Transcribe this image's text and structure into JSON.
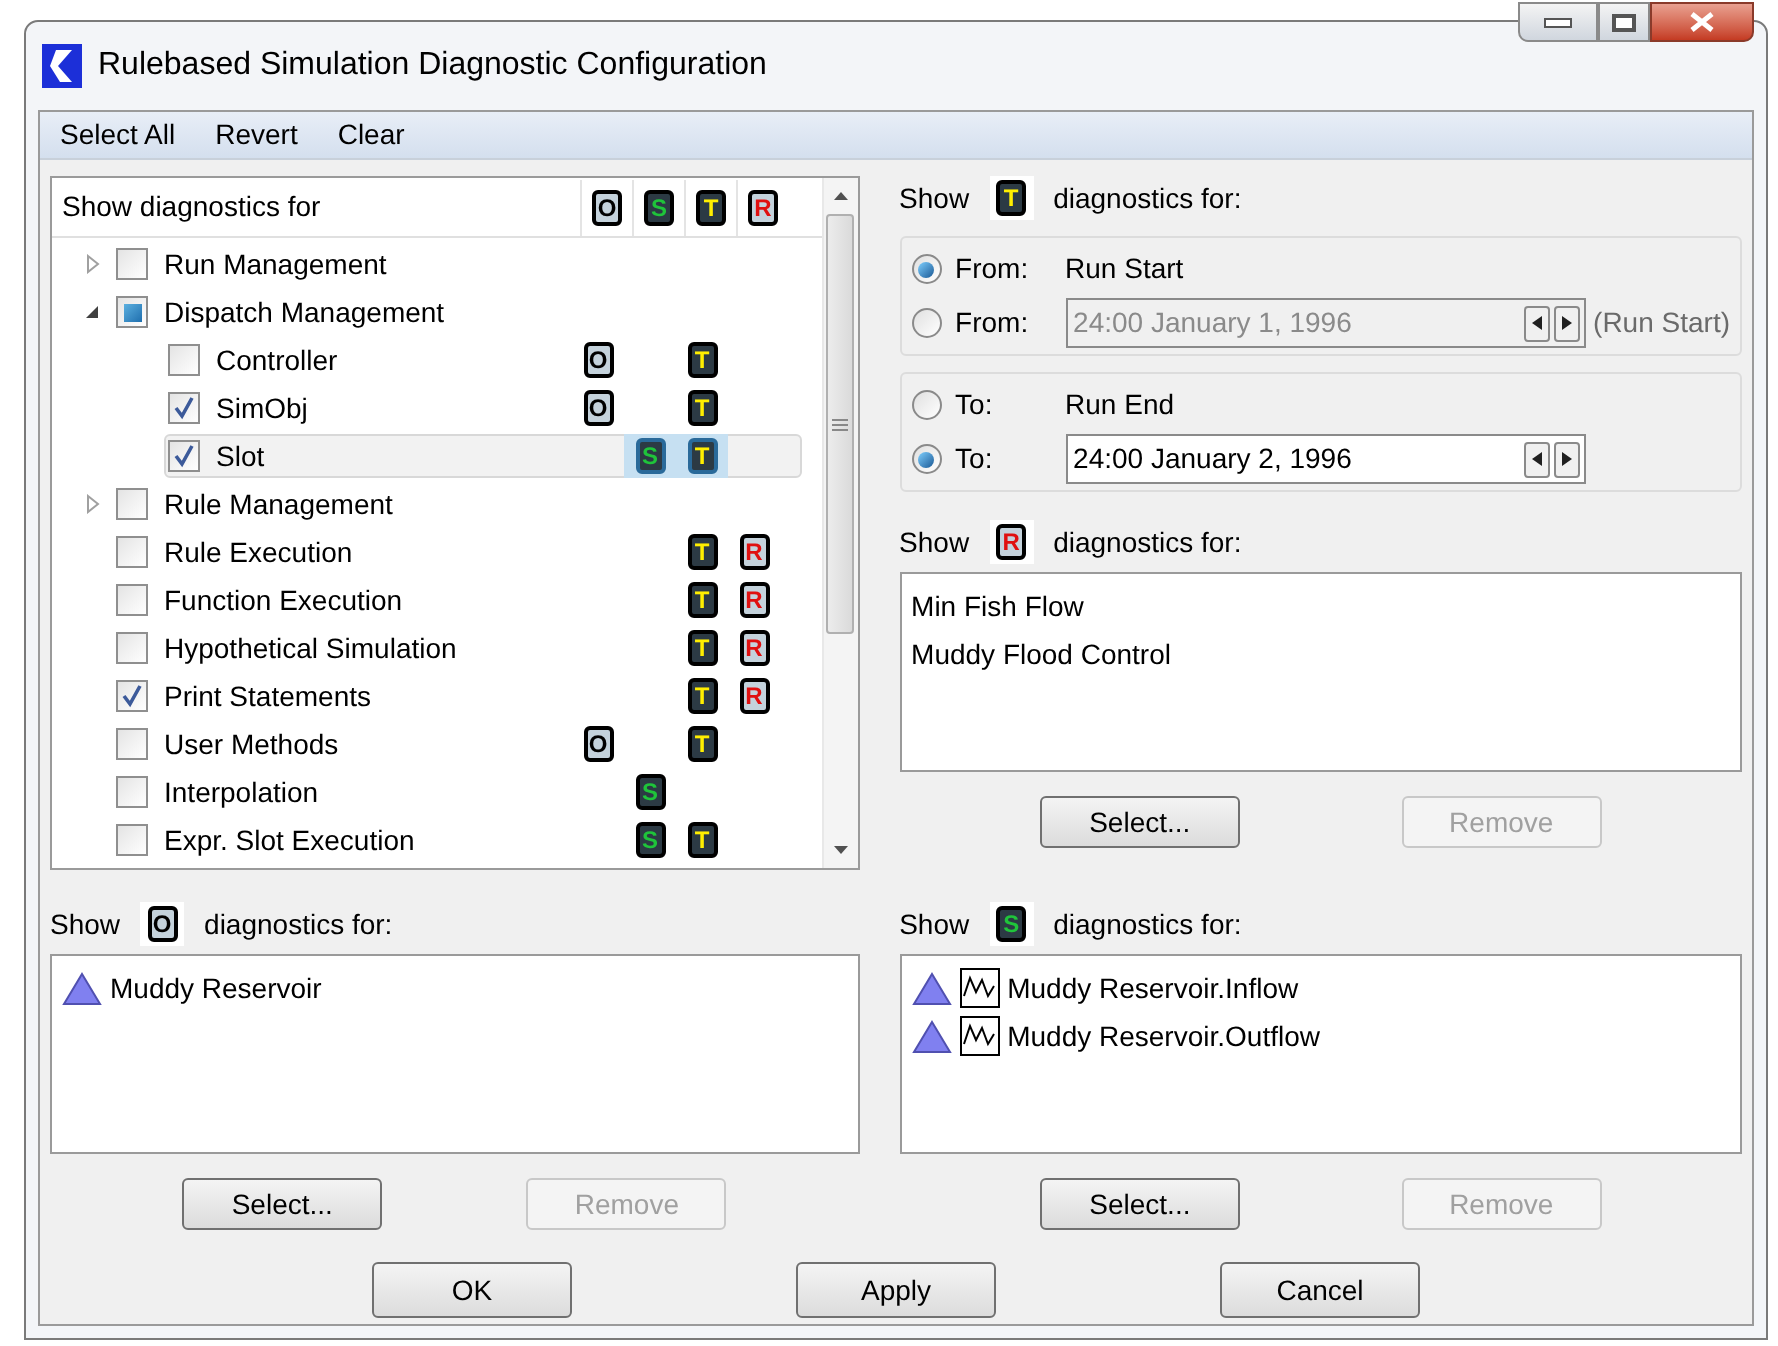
{
  "window": {
    "title": "Rulebased Simulation Diagnostic Configuration"
  },
  "menu": [
    "Select All",
    "Revert",
    "Clear"
  ],
  "tree": {
    "header": "Show diagnostics for",
    "columns": [
      {
        "kind": "o",
        "text": "O"
      },
      {
        "kind": "s",
        "text": "S"
      },
      {
        "kind": "t",
        "text": "T"
      },
      {
        "kind": "r",
        "text": "R"
      }
    ],
    "items": [
      {
        "label": "Run Management",
        "expanded": false,
        "checked": false,
        "mixed": false,
        "selected": false
      },
      {
        "label": "Dispatch Management",
        "expanded": true,
        "checked": false,
        "mixed": true,
        "selected": false,
        "children": [
          {
            "label": "Controller",
            "checked": false,
            "mixed": false,
            "selected": false,
            "badges": [
              {
                "kind": "o",
                "text": "O"
              },
              {
                "kind": "t",
                "text": "T"
              }
            ]
          },
          {
            "label": "SimObj",
            "checked": true,
            "mixed": false,
            "selected": false,
            "badges": [
              {
                "kind": "o",
                "text": "O"
              },
              {
                "kind": "t",
                "text": "T"
              }
            ]
          },
          {
            "label": "Slot",
            "checked": true,
            "mixed": false,
            "selected": true,
            "badges": [
              {
                "kind": "s",
                "text": "S"
              },
              {
                "kind": "t",
                "text": "T"
              }
            ]
          }
        ]
      },
      {
        "label": "Rule Management",
        "expanded": false,
        "checked": false,
        "mixed": false,
        "selected": false
      },
      {
        "label": "Rule Execution",
        "checked": false,
        "mixed": false,
        "selected": false,
        "badges": [
          {
            "kind": "t",
            "text": "T"
          },
          {
            "kind": "r",
            "text": "R"
          }
        ]
      },
      {
        "label": "Function Execution",
        "checked": false,
        "mixed": false,
        "selected": false,
        "badges": [
          {
            "kind": "t",
            "text": "T"
          },
          {
            "kind": "r",
            "text": "R"
          }
        ]
      },
      {
        "label": "Hypothetical Simulation",
        "checked": false,
        "mixed": false,
        "selected": false,
        "badges": [
          {
            "kind": "t",
            "text": "T"
          },
          {
            "kind": "r",
            "text": "R"
          }
        ]
      },
      {
        "label": "Print Statements",
        "checked": true,
        "mixed": false,
        "selected": false,
        "badges": [
          {
            "kind": "t",
            "text": "T"
          },
          {
            "kind": "r",
            "text": "R"
          }
        ]
      },
      {
        "label": "User Methods",
        "checked": false,
        "mixed": false,
        "selected": false,
        "badges": [
          {
            "kind": "o",
            "text": "O"
          },
          {
            "kind": "t",
            "text": "T"
          }
        ]
      },
      {
        "label": "Interpolation",
        "checked": false,
        "mixed": false,
        "selected": false,
        "badges": [
          {
            "kind": "s",
            "text": "S"
          }
        ]
      },
      {
        "label": "Expr. Slot Execution",
        "checked": false,
        "mixed": false,
        "selected": false,
        "badges": [
          {
            "kind": "s",
            "text": "S"
          },
          {
            "kind": "t",
            "text": "T"
          }
        ]
      }
    ]
  },
  "t_section": {
    "show": "Show",
    "badge": {
      "kind": "t",
      "text": "T"
    },
    "suffix": "diagnostics for:",
    "groups": [
      [
        {
          "label": "From:",
          "kind": "text",
          "value": "Run Start",
          "selected": true,
          "disabled": false
        },
        {
          "label": "From:",
          "kind": "date",
          "value": "24:00 January 1, 1996",
          "note": "(Run Start)",
          "selected": false,
          "disabled": true
        }
      ],
      [
        {
          "label": "To:",
          "kind": "text",
          "value": "Run End",
          "selected": false,
          "disabled": false
        },
        {
          "label": "To:",
          "kind": "date",
          "value": "24:00 January 2, 1996",
          "selected": true,
          "disabled": false
        }
      ]
    ]
  },
  "r_section": {
    "show": "Show",
    "badge": {
      "kind": "r",
      "text": "R"
    },
    "suffix": "diagnostics for:",
    "items": [
      {
        "text": "Min Fish Flow"
      },
      {
        "text": "Muddy Flood Control"
      }
    ],
    "buttons": [
      {
        "label": "Select...",
        "disabled": false
      },
      {
        "label": "Remove",
        "disabled": true
      }
    ]
  },
  "o_section": {
    "show": "Show",
    "badge": {
      "kind": "o",
      "text": "O"
    },
    "suffix": "diagnostics for:",
    "items": [
      {
        "text": "Muddy Reservoir",
        "kind": "object"
      }
    ],
    "buttons": [
      {
        "label": "Select...",
        "disabled": false
      },
      {
        "label": "Remove",
        "disabled": true
      }
    ]
  },
  "s_section": {
    "show": "Show",
    "badge": {
      "kind": "s",
      "text": "S"
    },
    "suffix": "diagnostics for:",
    "items": [
      {
        "text": "Muddy Reservoir.Inflow",
        "kind": "slot"
      },
      {
        "text": "Muddy Reservoir.Outflow",
        "kind": "slot"
      }
    ],
    "buttons": [
      {
        "label": "Select...",
        "disabled": false
      },
      {
        "label": "Remove",
        "disabled": true
      }
    ]
  },
  "footer": [
    "OK",
    "Apply",
    "Cancel"
  ]
}
